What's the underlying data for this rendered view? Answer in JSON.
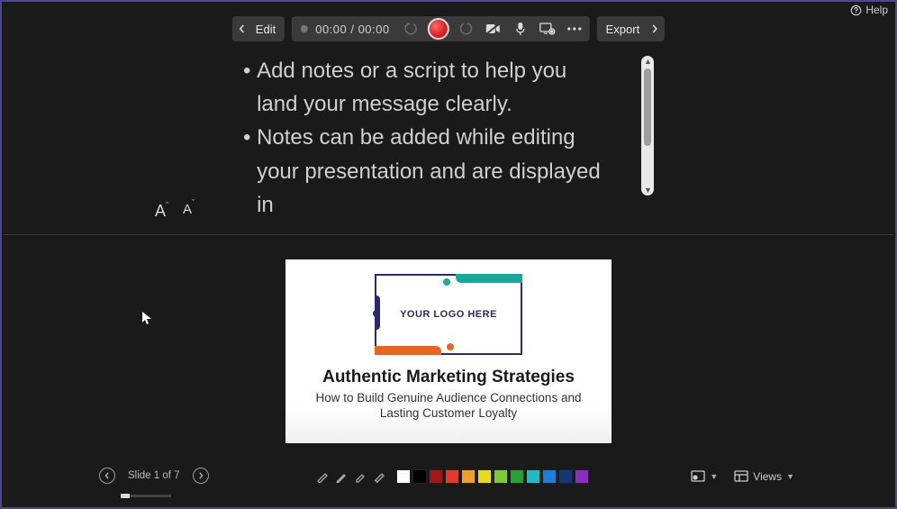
{
  "help": {
    "label": "Help"
  },
  "toolbar": {
    "edit_label": "Edit",
    "time": "00:00 / 00:00",
    "export_label": "Export"
  },
  "font_controls": {
    "increase_glyph": "A",
    "increase_sup": "ˆ",
    "decrease_glyph": "A",
    "decrease_sup": "ˇ"
  },
  "notes": {
    "bullets": [
      "Add notes or a script to help you land your message clearly.",
      "Notes can be added while editing your presentation and are displayed in"
    ]
  },
  "slide": {
    "logo_text": "YOUR LOGO HERE",
    "title": "Authentic Marketing Strategies",
    "subtitle": "How to Build Genuine Audience Connections and Lasting Customer Loyalty"
  },
  "bottombar": {
    "slide_counter": "Slide 1 of 7",
    "views_label": "Views"
  },
  "colors": {
    "swatches": [
      "#ffffff",
      "#000000",
      "#a11815",
      "#e23b2e",
      "#f0a020",
      "#e6dc1c",
      "#7ec93a",
      "#2aa135",
      "#1fbcc4",
      "#1a7fd6",
      "#16367a",
      "#8a2dc0"
    ]
  }
}
